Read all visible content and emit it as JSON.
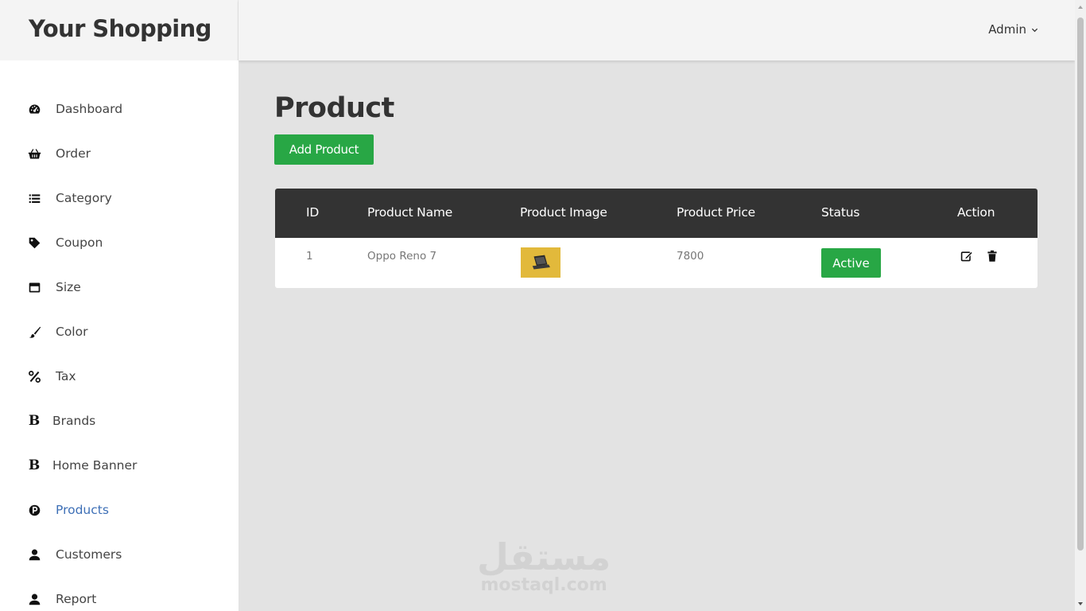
{
  "brand": "Your Shopping",
  "header": {
    "user_menu": "Admin"
  },
  "sidebar": {
    "items": [
      {
        "label": "Dashboard",
        "icon": "dashboard-icon"
      },
      {
        "label": "Order",
        "icon": "basket-icon"
      },
      {
        "label": "Category",
        "icon": "list-icon"
      },
      {
        "label": "Coupon",
        "icon": "tag-icon"
      },
      {
        "label": "Size",
        "icon": "window-icon"
      },
      {
        "label": "Color",
        "icon": "paint-brush-icon"
      },
      {
        "label": "Tax",
        "icon": "percent-icon"
      },
      {
        "label": "Brands",
        "icon": "brand-b-icon"
      },
      {
        "label": "Home Banner",
        "icon": "brand-b-icon"
      },
      {
        "label": "Products",
        "icon": "product-p-icon",
        "active": true
      },
      {
        "label": "Customers",
        "icon": "user-icon"
      },
      {
        "label": "Report",
        "icon": "user-icon"
      }
    ]
  },
  "main": {
    "title": "Product",
    "add_button": "Add Product",
    "table": {
      "columns": [
        "ID",
        "Product Name",
        "Product Image",
        "Product Price",
        "Status",
        "Action"
      ],
      "rows": [
        {
          "id": "1",
          "name": "Oppo Reno 7",
          "image": "product-thumbnail",
          "price": "7800",
          "status": "Active"
        }
      ]
    }
  },
  "watermark": {
    "arabic": "مستقل",
    "latin": "mostaql.com"
  },
  "colors": {
    "accent_green": "#28a745",
    "header_dark": "#333333",
    "active_link": "#3d6fb6",
    "thumb_bg": "#e2b93b"
  }
}
